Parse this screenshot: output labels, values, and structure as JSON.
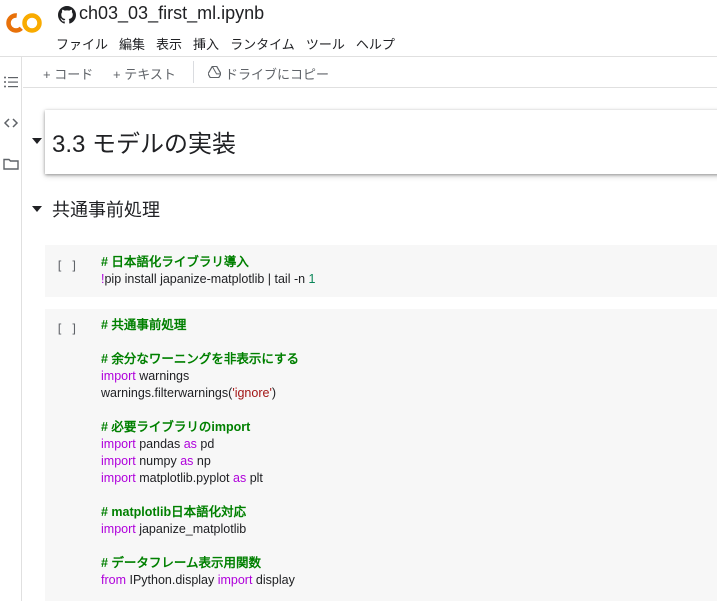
{
  "header": {
    "notebook_title": "ch03_03_first_ml.ipynb",
    "logo_text": "CO",
    "menu": [
      "ファイル",
      "編集",
      "表示",
      "挿入",
      "ランタイム",
      "ツール",
      "ヘルプ"
    ]
  },
  "toolbar": {
    "add_code": "+ コード",
    "add_text": "+ テキスト",
    "copy_to_drive": "ドライブにコピー"
  },
  "sections": {
    "title": "3.3 モデルの実装",
    "subtitle": "共通事前処理"
  },
  "cells": [
    {
      "run_label": "[ ]",
      "lines": [
        [
          {
            "t": "# 日本語化ライブラリ導入",
            "c": "cm"
          }
        ],
        [
          {
            "t": "!",
            "c": "kw"
          },
          {
            "t": "pip install japanize-matplotlib | tail -n ",
            "c": ""
          },
          {
            "t": "1",
            "c": "nu"
          }
        ]
      ]
    },
    {
      "run_label": "[ ]",
      "lines": [
        [
          {
            "t": "# 共通事前処理",
            "c": "cm"
          }
        ],
        [],
        [
          {
            "t": "# 余分なワーニングを非表示にする",
            "c": "cm"
          }
        ],
        [
          {
            "t": "import",
            "c": "kw"
          },
          {
            "t": " warnings",
            "c": ""
          }
        ],
        [
          {
            "t": "warnings.filterwarnings(",
            "c": ""
          },
          {
            "t": "'ignore'",
            "c": "st"
          },
          {
            "t": ")",
            "c": ""
          }
        ],
        [],
        [
          {
            "t": "# 必要ライブラリのimport",
            "c": "cm"
          }
        ],
        [
          {
            "t": "import",
            "c": "kw"
          },
          {
            "t": " pandas ",
            "c": ""
          },
          {
            "t": "as",
            "c": "kw"
          },
          {
            "t": " pd",
            "c": ""
          }
        ],
        [
          {
            "t": "import",
            "c": "kw"
          },
          {
            "t": " numpy ",
            "c": ""
          },
          {
            "t": "as",
            "c": "kw"
          },
          {
            "t": " np",
            "c": ""
          }
        ],
        [
          {
            "t": "import",
            "c": "kw"
          },
          {
            "t": " matplotlib.pyplot ",
            "c": ""
          },
          {
            "t": "as",
            "c": "kw"
          },
          {
            "t": " plt",
            "c": ""
          }
        ],
        [],
        [
          {
            "t": "# matplotlib日本語化対応",
            "c": "cm"
          }
        ],
        [
          {
            "t": "import",
            "c": "kw"
          },
          {
            "t": " japanize_matplotlib",
            "c": ""
          }
        ],
        [],
        [
          {
            "t": "# データフレーム表示用関数",
            "c": "cm"
          }
        ],
        [
          {
            "t": "from",
            "c": "kw"
          },
          {
            "t": " IPython.display ",
            "c": ""
          },
          {
            "t": "import",
            "c": "kw"
          },
          {
            "t": " display",
            "c": ""
          }
        ]
      ]
    }
  ],
  "colors": {
    "logo_orange": "#F9AB00",
    "logo_dark_orange": "#E8710A",
    "comment": "#008000",
    "keyword": "#AF00DB",
    "string": "#A31515",
    "number": "#098658",
    "cell_bg": "#F7F7F7"
  }
}
